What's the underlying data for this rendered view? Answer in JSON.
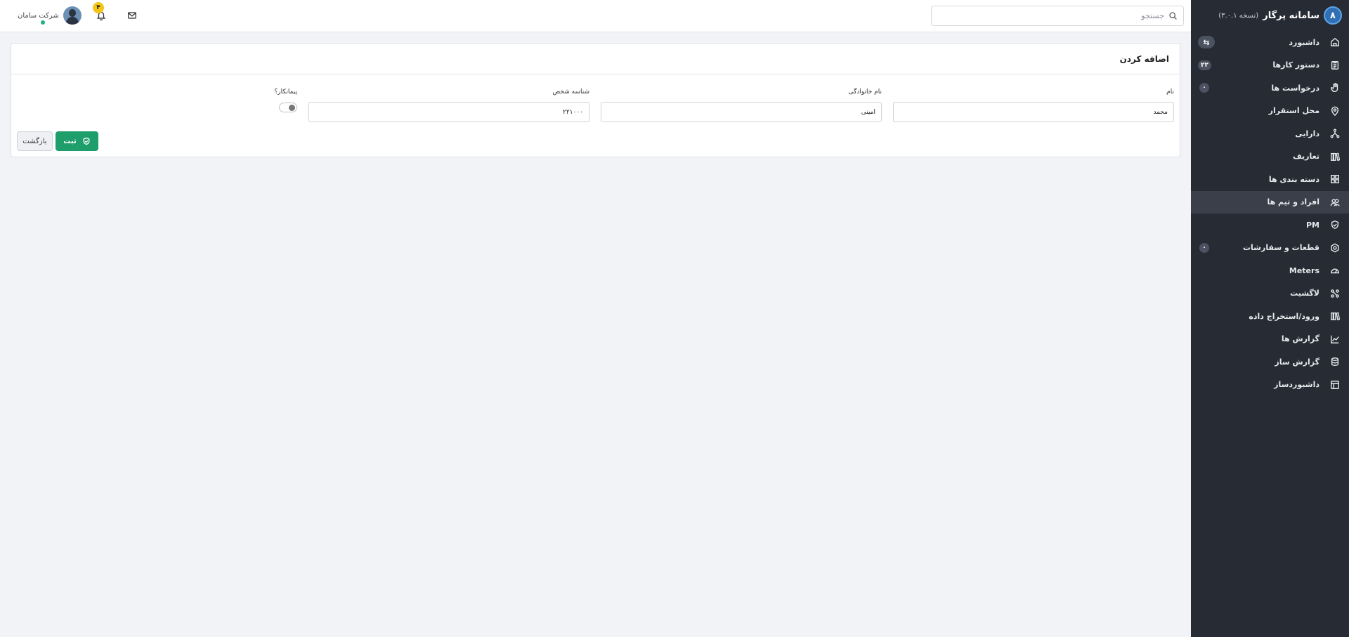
{
  "sidebar": {
    "brand": {
      "title": "سامانه پرگار",
      "version": "(نسخه ۳.۰.۱)"
    },
    "items": [
      {
        "label": "داشبورد",
        "icon": "home-icon"
      },
      {
        "label": "دستور کارها",
        "icon": "clipboard-icon",
        "badge": "۲۲"
      },
      {
        "label": "درخواست ها",
        "icon": "hand-icon",
        "badge": "۰"
      },
      {
        "label": "محل استقرار",
        "icon": "location-pin-icon"
      },
      {
        "label": "دارایی",
        "icon": "asset-tree-icon"
      },
      {
        "label": "تعاریف",
        "icon": "books-icon"
      },
      {
        "label": "دسته بندی ها",
        "icon": "grid-icon"
      },
      {
        "label": "افراد و تیم ها",
        "icon": "users-icon"
      },
      {
        "label": "PM",
        "icon": "shield-icon"
      },
      {
        "label": "قطعات و سفارشات",
        "icon": "hexagon-icon",
        "badge": "۰"
      },
      {
        "label": "Meters",
        "icon": "gauge-icon"
      },
      {
        "label": "لاگشیت",
        "icon": "nodes-icon"
      },
      {
        "label": "ورود/استخراج داده",
        "icon": "import-export-icon"
      },
      {
        "label": "گزارش ها",
        "icon": "line-chart-icon"
      },
      {
        "label": "گزارش ساز",
        "icon": "database-icon"
      },
      {
        "label": "داشبوردساز",
        "icon": "layout-icon"
      }
    ],
    "active_item": "افراد و تیم ها"
  },
  "topbar": {
    "search_placeholder": "جستجو",
    "notification_count": "۴",
    "user_name": "شرکت سامان"
  },
  "form": {
    "title": "اضافه کردن",
    "first_name_label": "نام",
    "first_name_value": "محمد",
    "last_name_label": "نام خانوادگی",
    "last_name_value": "امینی",
    "person_id_label": "شناسه شخص",
    "person_id_value": "۲۲۱۰۰۰",
    "contractor_label": "پیمانکار؟",
    "contractor_value": false,
    "save_label": "ثبت",
    "back_label": "بازگشت"
  },
  "colors": {
    "sidebar_bg": "#272b34",
    "primary_green": "#1e9e6a",
    "badge_yellow": "#f5c518"
  }
}
